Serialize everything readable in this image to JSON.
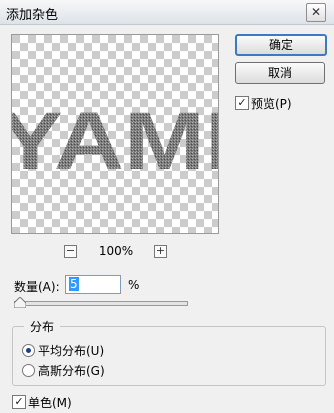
{
  "window": {
    "title": "添加杂色",
    "close_glyph": "✕"
  },
  "preview": {
    "text": "YAMI"
  },
  "zoom": {
    "level": "100%",
    "minus_glyph": "−",
    "plus_glyph": "+"
  },
  "buttons": {
    "ok": "确定",
    "cancel": "取消"
  },
  "preview_toggle": {
    "label": "预览(P)",
    "checked": true
  },
  "amount": {
    "label": "数量(A):",
    "value": "5",
    "unit": "%",
    "slider_fraction": 0.012
  },
  "distribution": {
    "title": "分布",
    "options": [
      {
        "label": "平均分布(U)",
        "selected": true
      },
      {
        "label": "高斯分布(G)",
        "selected": false
      }
    ]
  },
  "monochrome": {
    "label": "单色(M)",
    "checked": true
  },
  "check_glyph": "✓"
}
